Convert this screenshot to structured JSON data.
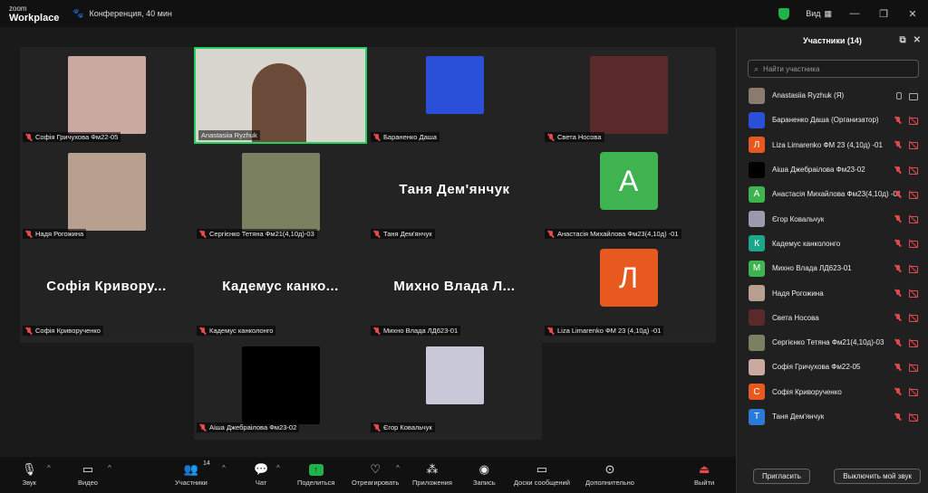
{
  "app": {
    "logo_line1": "zoom",
    "logo_line2": "Workplace",
    "meeting_label": "Конференция, 40 мин",
    "view_label": "Вид"
  },
  "tiles": [
    {
      "name": "Софія Гричухова Фм22-05",
      "kind": "photo",
      "color": "#c9a9a0"
    },
    {
      "name": "Anastasiia Ryzhuk",
      "kind": "video",
      "color": "#d8d6cf",
      "active": true
    },
    {
      "name": "Бараненко Даша",
      "kind": "photo",
      "color": "#2a4fd8"
    },
    {
      "name": "Света Носова",
      "kind": "photo",
      "color": "#5a2a2a"
    },
    {
      "name": "Надя Рогожина",
      "kind": "photo",
      "color": "#b8a090"
    },
    {
      "name": "Сергієнко Тетяна Фм21(4,10д)-03",
      "kind": "photo",
      "color": "#7a8060"
    },
    {
      "name": "Таня Дем'янчук",
      "kind": "text",
      "big": "Таня Дем'янчук"
    },
    {
      "name": "Анастасія Михайлова Фм23(4,10д) -01",
      "kind": "letter",
      "letter": "A",
      "color": "#3fb34f"
    },
    {
      "name": "Софія Криворученко",
      "kind": "text",
      "big": "Софія Кривору..."
    },
    {
      "name": "Кадемус канколонго",
      "kind": "text",
      "big": "Кадемус канко..."
    },
    {
      "name": "Михно Влада ЛД623-01",
      "kind": "text",
      "big": "Михно Влада Л..."
    },
    {
      "name": "Liza Limarenko ФМ 23 (4,10д) -01",
      "kind": "letter",
      "letter": "Л",
      "color": "#e8591f"
    },
    {
      "name": "Аіша Джебраілова Фм23-02",
      "kind": "photo",
      "color": "#000000"
    },
    {
      "name": "Єгор Ковальчук",
      "kind": "photo",
      "color": "#c8c8d8"
    }
  ],
  "panel": {
    "title": "Участники (14)",
    "search_placeholder": "Найти участника",
    "participants": [
      {
        "name": "Anastasiia Ryzhuk (Я)",
        "av": "",
        "color": "#8a7a70",
        "self": true
      },
      {
        "name": "Бараненко Даша (Организатор)",
        "av": "",
        "color": "#2a4fd8"
      },
      {
        "name": "Liza Limarenko ФМ 23 (4,10д) -01",
        "av": "Л",
        "color": "#e8591f"
      },
      {
        "name": "Аіша Джебраілова Фм23-02",
        "av": "",
        "color": "#000000"
      },
      {
        "name": "Анастасія Михайлова Фм23(4,10д) -01",
        "av": "A",
        "color": "#3fb34f"
      },
      {
        "name": "Єгор Ковальчук",
        "av": "",
        "color": "#9a9aae"
      },
      {
        "name": "Кадемус канколонго",
        "av": "К",
        "color": "#1aa888"
      },
      {
        "name": "Михно Влада ЛД623-01",
        "av": "М",
        "color": "#3fb34f"
      },
      {
        "name": "Надя Рогожина",
        "av": "",
        "color": "#b8a090"
      },
      {
        "name": "Света Носова",
        "av": "",
        "color": "#5a2a2a"
      },
      {
        "name": "Сергієнко Тетяна Фм21(4,10д)-03",
        "av": "",
        "color": "#7a8060"
      },
      {
        "name": "Софія Гричухова Фм22-05",
        "av": "",
        "color": "#c9a9a0"
      },
      {
        "name": "Софія Криворученко",
        "av": "С",
        "color": "#e8591f"
      },
      {
        "name": "Таня Дем'янчук",
        "av": "Т",
        "color": "#2a7ad8"
      }
    ],
    "invite_label": "Пригласить",
    "mute_label": "Выключить мой звук"
  },
  "toolbar": {
    "audio": "Звук",
    "video": "Видео",
    "participants": "Участники",
    "participants_count": "14",
    "chat": "Чат",
    "share": "Поделиться",
    "react": "Отреагировать",
    "apps": "Приложения",
    "record": "Запись",
    "whiteboard": "Доски сообщений",
    "more": "Дополнительно",
    "leave": "Выйти"
  }
}
